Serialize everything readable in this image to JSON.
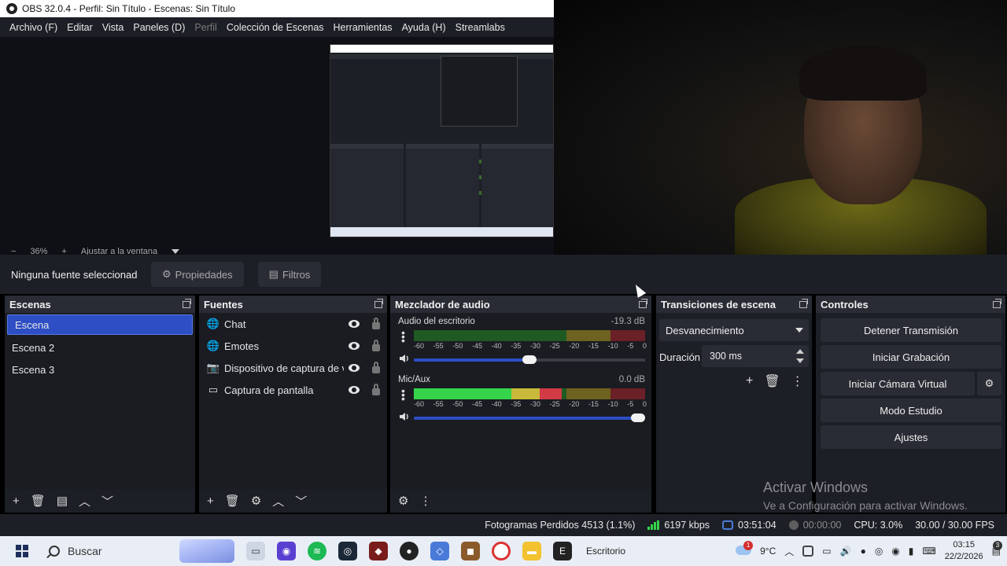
{
  "window": {
    "title": "OBS 32.0.4 - Perfil: Sin Título - Escenas: Sin Título"
  },
  "menu": {
    "items": [
      {
        "label": "Archivo (F)"
      },
      {
        "label": "Editar"
      },
      {
        "label": "Vista"
      },
      {
        "label": "Paneles (D)"
      },
      {
        "label": "Perfil",
        "disabled": true
      },
      {
        "label": "Colección de Escenas"
      },
      {
        "label": "Herramientas"
      },
      {
        "label": "Ayuda (H)"
      },
      {
        "label": "Streamlabs"
      }
    ]
  },
  "preview": {
    "zoom": "36%",
    "fit_label": "Ajustar a la ventana"
  },
  "context": {
    "no_selection": "Ninguna fuente seleccionada",
    "properties": "Propiedades",
    "filters": "Filtros"
  },
  "scenes": {
    "title": "Escenas",
    "items": [
      "Escena",
      "Escena 2",
      "Escena 3"
    ],
    "selected_index": 0
  },
  "sources": {
    "title": "Fuentes",
    "items": [
      {
        "name": "Chat",
        "icon": "browser-icon"
      },
      {
        "name": "Emotes",
        "icon": "browser-icon"
      },
      {
        "name": "Dispositivo de captura de video",
        "icon": "camera-icon"
      },
      {
        "name": "Captura de pantalla",
        "icon": "monitor-icon"
      }
    ]
  },
  "mixer": {
    "title": "Mezclador de audio",
    "scale": [
      "-60",
      "-55",
      "-50",
      "-45",
      "-40",
      "-35",
      "-30",
      "-25",
      "-20",
      "-15",
      "-10",
      "-5",
      "0"
    ],
    "tracks": [
      {
        "name": "Audio del escritorio",
        "db": "-19.3 dB",
        "level": 0.0,
        "volume": 0.5
      },
      {
        "name": "Mic/Aux",
        "db": "0.0 dB",
        "level": 0.64,
        "volume": 1.0
      }
    ]
  },
  "transitions": {
    "title": "Transiciones de escena",
    "selected": "Desvanecimiento",
    "duration_label": "Duración",
    "duration_value": "300 ms"
  },
  "controls": {
    "title": "Controles",
    "stop_stream": "Detener Transmisión",
    "start_recording": "Iniciar Grabación",
    "start_virtual_cam": "Iniciar Cámara Virtual",
    "studio_mode": "Modo Estudio",
    "settings": "Ajustes"
  },
  "watermark": {
    "line1": "Activar Windows",
    "line2": "Ve a Configuración para activar Windows."
  },
  "status": {
    "dropped_frames": "Fotogramas Perdidos 4513 (1.1%)",
    "bitrate": "6197 kbps",
    "stream_time": "03:51:04",
    "rec_time": "00:00:00",
    "cpu": "CPU: 3.0%",
    "fps": "30.00 / 30.00 FPS"
  },
  "taskbar": {
    "search_placeholder": "Buscar",
    "desktop_label": "Escritorio",
    "weather": "9°C",
    "weather_badge": "1",
    "time": "03:15",
    "date": "22/2/2026",
    "notif_count": "3"
  },
  "colors": {
    "accent": "#2d4ec4",
    "panel": "#1d1f26",
    "meter_green": "#35d44a"
  }
}
